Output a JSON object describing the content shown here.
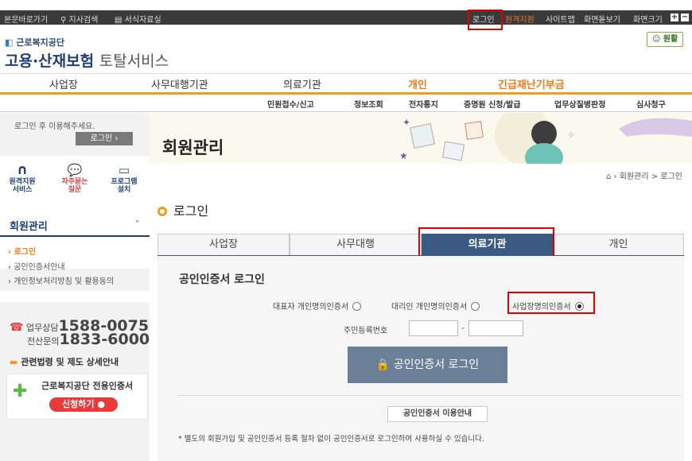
{
  "topbar": {
    "skip": "본문바로가기",
    "branch": "지사검색",
    "forms": "서식자료실",
    "login": "로그인",
    "remote": "원격지원",
    "sitemap": "사이트맵",
    "screen_view": "화면돋보기",
    "screen_size": "화면크기"
  },
  "header": {
    "org": "근로복지공단",
    "title_main": "고용·산재보험",
    "title_sub": "토탈서비스",
    "win_label": "원활"
  },
  "nav": {
    "items": [
      "사업장",
      "사무대행기관",
      "의료기관",
      "개인",
      "긴급재난기부금"
    ]
  },
  "subnav": {
    "items": [
      "민원접수/신고",
      "정보조회",
      "전자통지",
      "증명원 신청/발급",
      "업무상질병판정",
      "심사청구"
    ]
  },
  "sidebar": {
    "login_msg": "로그인 후 이용해주세요.",
    "login_btn": "로그인",
    "quick": [
      "원격지원\n서비스",
      "자주묻는\n질문",
      "프로그램\n설치"
    ],
    "section": "회원관리",
    "links": [
      "로그인",
      "공인인증서안내",
      "개인정보처리방침 및 활용동의"
    ],
    "phone1_label": "업무상담",
    "phone1": "1588-0075",
    "phone2_label": "전산문의",
    "phone2": "1833-6000",
    "law": "관련법령 및 제도 상세안내",
    "cert_title": "근로복지공단 전용인증서",
    "apply_btn": "신청하기"
  },
  "main": {
    "page_title": "회원관리",
    "breadcrumb": "회원관리 > 로그인",
    "section_title": "로그인",
    "tabs": [
      "사업장",
      "사무대행",
      "의료기관",
      "개인"
    ],
    "cert_title": "공인인증서 로그인",
    "radios": [
      {
        "label": "대표자 개인명의인증서",
        "checked": false
      },
      {
        "label": "대리인 개인명의인증서",
        "checked": false
      },
      {
        "label": "사업장명의인증서",
        "checked": true
      }
    ],
    "ssn_label": "주민등록번호",
    "login_btn": "공인인증서 로그인",
    "guide_btn": "공인인증서 이용안내",
    "note": "* 별도의 회원가입 및 공인인증서 등록 절차 없이 공인인증서로 로그인하여 사용하실 수 있습니다."
  },
  "colors": {
    "accent": "#f39b1d",
    "navy": "#1f3f77",
    "tab_active": "#3b5a82",
    "highlight": "#e00000"
  }
}
